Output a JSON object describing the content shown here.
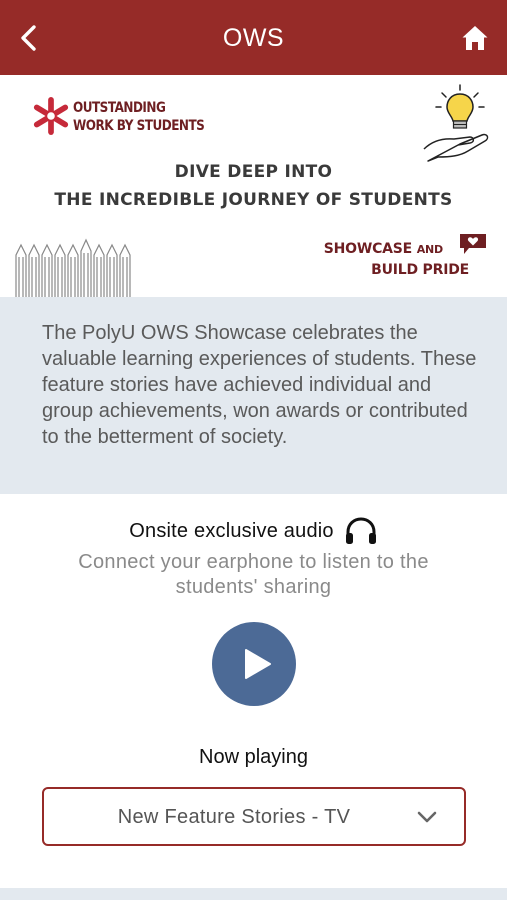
{
  "header": {
    "title": "OWS",
    "back_icon": "chevron-left-icon",
    "home_icon": "home-icon",
    "background_color": "#962b28"
  },
  "banner": {
    "logo_line1": "OUTSTANDING",
    "logo_line2": "WORK BY STUDENTS",
    "headline_line1": "DIVE DEEP INTO",
    "headline_line2": "THE INCREDIBLE JOURNEY OF STUDENTS",
    "showcase_line1_a": "SHOWCASE",
    "showcase_line1_b": "AND",
    "showcase_line2": "BUILD PRIDE",
    "accent_color": "#6e1f22",
    "logo_star_color": "#c62a3a"
  },
  "intro": {
    "text": "The PolyU OWS Showcase celebrates the valuable learning experiences of students. These feature stories have achieved individual and group achievements, won awards or contributed to the betterment of society."
  },
  "audio": {
    "title": "Onsite exclusive audio",
    "title_icon": "headphones-icon",
    "subtitle": "Connect your earphone to listen to the students' sharing",
    "play_icon": "play-icon",
    "play_color": "#4c6a96",
    "now_playing_label": "Now playing",
    "selected_track": "New Feature Stories - TV",
    "dropdown_icon": "chevron-down-icon"
  }
}
